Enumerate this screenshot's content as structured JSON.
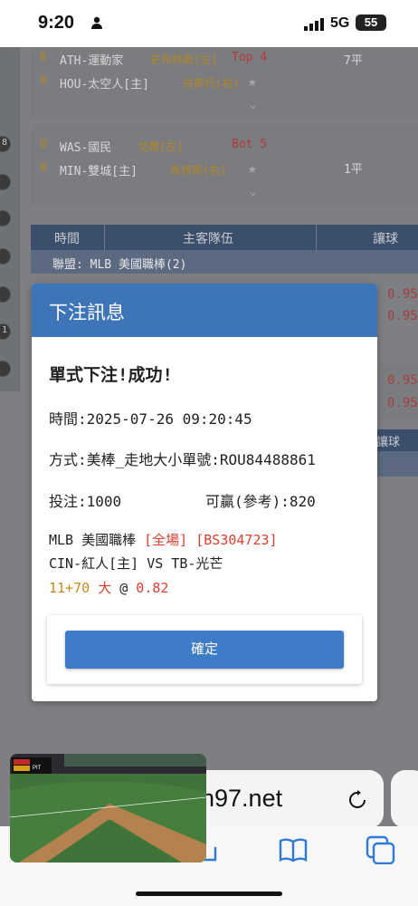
{
  "status_bar": {
    "time": "9:20",
    "network": "5G",
    "battery": "55"
  },
  "games": [
    {
      "lines": [
        {
          "num": "6",
          "team": "ATH-運動家",
          "pitcher": "史布林斯[左]",
          "inning": "Top 4",
          "spread": "7平"
        },
        {
          "num": "0",
          "team": "HOU-太空人[主]",
          "pitcher": "古斯托[右]"
        }
      ]
    },
    {
      "lines": [
        {
          "num": "0",
          "team": "WAS-國民",
          "pitcher": "戈爾[左]",
          "inning": "Bot 5"
        },
        {
          "num": "0",
          "team": "MIN-雙城[主]",
          "pitcher": "馬修斯[右]",
          "spread": "1平"
        }
      ]
    }
  ],
  "table_header": {
    "col_time": "時間",
    "col_teams": "主客隊伍",
    "col_handicap": "讓球"
  },
  "league_label": "聯盟: MLB 美國職棒(2)",
  "odds_peek": [
    "0.95",
    "0.95",
    "0.95",
    "0.95"
  ],
  "handicap_peek": "讓球",
  "left_badges": [
    "8",
    "1"
  ],
  "modal": {
    "title": "下注訊息",
    "heading": "單式下注!成功!",
    "time": "時間:2025-07-26 09:20:45",
    "method": "方式:美棒_走地大小單號:ROU84488861",
    "stake": "投注:1000",
    "win": "可贏(參考):820",
    "league": "MLB 美國職棒",
    "period": "[全場]",
    "ticket": "[BS304723]",
    "matchup": "CIN-紅人[主] VS TB-光芒",
    "score": "11+70",
    "pick": "大",
    "at": "@",
    "odds": "0.82",
    "confirm": "確定"
  },
  "browser": {
    "url": "n97.net"
  },
  "video": {
    "scoreboard": "PIT"
  }
}
